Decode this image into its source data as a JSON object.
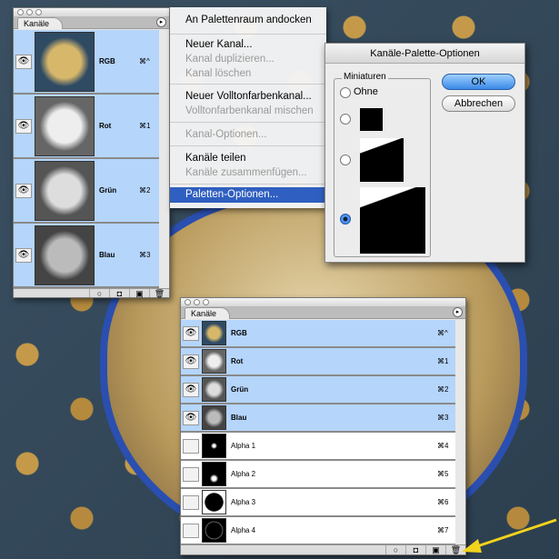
{
  "palette_top": {
    "tab": "Kanäle",
    "channels": [
      {
        "name": "RGB",
        "shortcut": "⌘^"
      },
      {
        "name": "Rot",
        "shortcut": "⌘1"
      },
      {
        "name": "Grün",
        "shortcut": "⌘2"
      },
      {
        "name": "Blau",
        "shortcut": "⌘3"
      }
    ]
  },
  "menu": {
    "items": [
      {
        "label": "An Palettenraum andocken",
        "enabled": true
      },
      {
        "label": "Neuer Kanal...",
        "enabled": true
      },
      {
        "label": "Kanal duplizieren...",
        "enabled": false
      },
      {
        "label": "Kanal löschen",
        "enabled": false
      },
      {
        "label": "Neuer Volltonfarbenkanal...",
        "enabled": true
      },
      {
        "label": "Volltonfarbenkanal mischen",
        "enabled": false
      },
      {
        "label": "Kanal-Optionen...",
        "enabled": false
      },
      {
        "label": "Kanäle teilen",
        "enabled": true
      },
      {
        "label": "Kanäle zusammenfügen...",
        "enabled": false
      },
      {
        "label": "Paletten-Optionen...",
        "enabled": true,
        "highlighted": true
      }
    ]
  },
  "dialog": {
    "title": "Kanäle-Palette-Optionen",
    "group": "Miniaturen",
    "option_none": "Ohne",
    "selected": "large",
    "ok": "OK",
    "cancel": "Abbrechen"
  },
  "palette_bottom": {
    "tab": "Kanäle",
    "channels": [
      {
        "name": "RGB",
        "shortcut": "⌘^",
        "visible": true
      },
      {
        "name": "Rot",
        "shortcut": "⌘1",
        "visible": true
      },
      {
        "name": "Grün",
        "shortcut": "⌘2",
        "visible": true
      },
      {
        "name": "Blau",
        "shortcut": "⌘3",
        "visible": true
      },
      {
        "name": "Alpha 1",
        "shortcut": "⌘4",
        "visible": false
      },
      {
        "name": "Alpha 2",
        "shortcut": "⌘5",
        "visible": false
      },
      {
        "name": "Alpha 3",
        "shortcut": "⌘6",
        "visible": false
      },
      {
        "name": "Alpha 4",
        "shortcut": "⌘7",
        "visible": false
      }
    ]
  },
  "colors": {
    "selection": "#b5d5fb",
    "menu_highlight": "#2f5fc0",
    "arrow": "#f2d21c"
  }
}
